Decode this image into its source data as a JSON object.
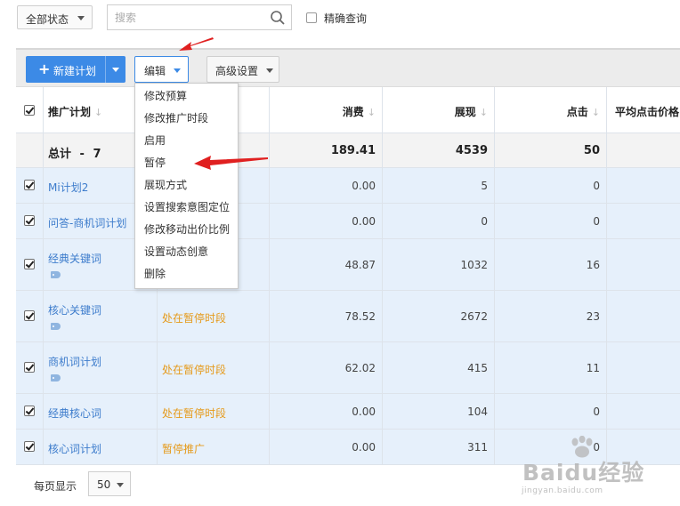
{
  "filter": {
    "status_label": "全部状态",
    "search_placeholder": "搜索",
    "exact_label": "精确查询"
  },
  "toolbar": {
    "new_plan_label": "新建计划",
    "edit_label": "编辑",
    "advanced_label": "高级设置"
  },
  "table": {
    "headers": {
      "plan": "推广计划",
      "spend": "消费",
      "impressions": "展现",
      "clicks": "点击",
      "avg_cpc": "平均点击价格"
    },
    "total": {
      "label": "总计",
      "separator": "-",
      "count": "7",
      "spend": "189.41",
      "impressions": "4539",
      "clicks": "50"
    },
    "rows": [
      {
        "name": "Mi计划2",
        "status": "",
        "spend": "0.00",
        "impressions": "5",
        "clicks": "0",
        "tag": false
      },
      {
        "name": "问答-商机词计划",
        "status": "",
        "spend": "0.00",
        "impressions": "0",
        "clicks": "0",
        "tag": false
      },
      {
        "name": "经典关键词",
        "status": "",
        "spend": "48.87",
        "impressions": "1032",
        "clicks": "16",
        "tag": true
      },
      {
        "name": "核心关键词",
        "status": "处在暂停时段",
        "spend": "78.52",
        "impressions": "2672",
        "clicks": "23",
        "tag": true
      },
      {
        "name": "商机词计划",
        "status": "处在暂停时段",
        "spend": "62.02",
        "impressions": "415",
        "clicks": "11",
        "tag": true
      },
      {
        "name": "经典核心词",
        "status": "处在暂停时段",
        "spend": "0.00",
        "impressions": "104",
        "clicks": "0",
        "tag": false
      },
      {
        "name": "核心词计划",
        "status": "暂停推广",
        "spend": "0.00",
        "impressions": "311",
        "clicks": "0",
        "tag": false
      }
    ]
  },
  "footer": {
    "page_size_label": "每页显示",
    "page_size_value": "50"
  },
  "edit_menu": {
    "items": [
      "修改预算",
      "修改推广时段",
      "启用",
      "暂停",
      "展现方式",
      "设置搜索意图定位",
      "修改移动出价比例",
      "设置动态创意",
      "删除"
    ]
  },
  "watermark": {
    "brand": "Baidu经验",
    "url": "jingyan.baidu.com"
  },
  "colors": {
    "primary": "#3c8ae6",
    "row_highlight": "#e6f0fb",
    "status_paused": "#e59a1b",
    "link": "#3d7ccc",
    "annotation_arrow": "#e02020"
  },
  "icons": [
    "search-icon",
    "plus-icon",
    "chevron-down-icon",
    "sort-arrow-icon",
    "tag-icon",
    "checkbox-icon",
    "annotation-arrow-icon"
  ]
}
